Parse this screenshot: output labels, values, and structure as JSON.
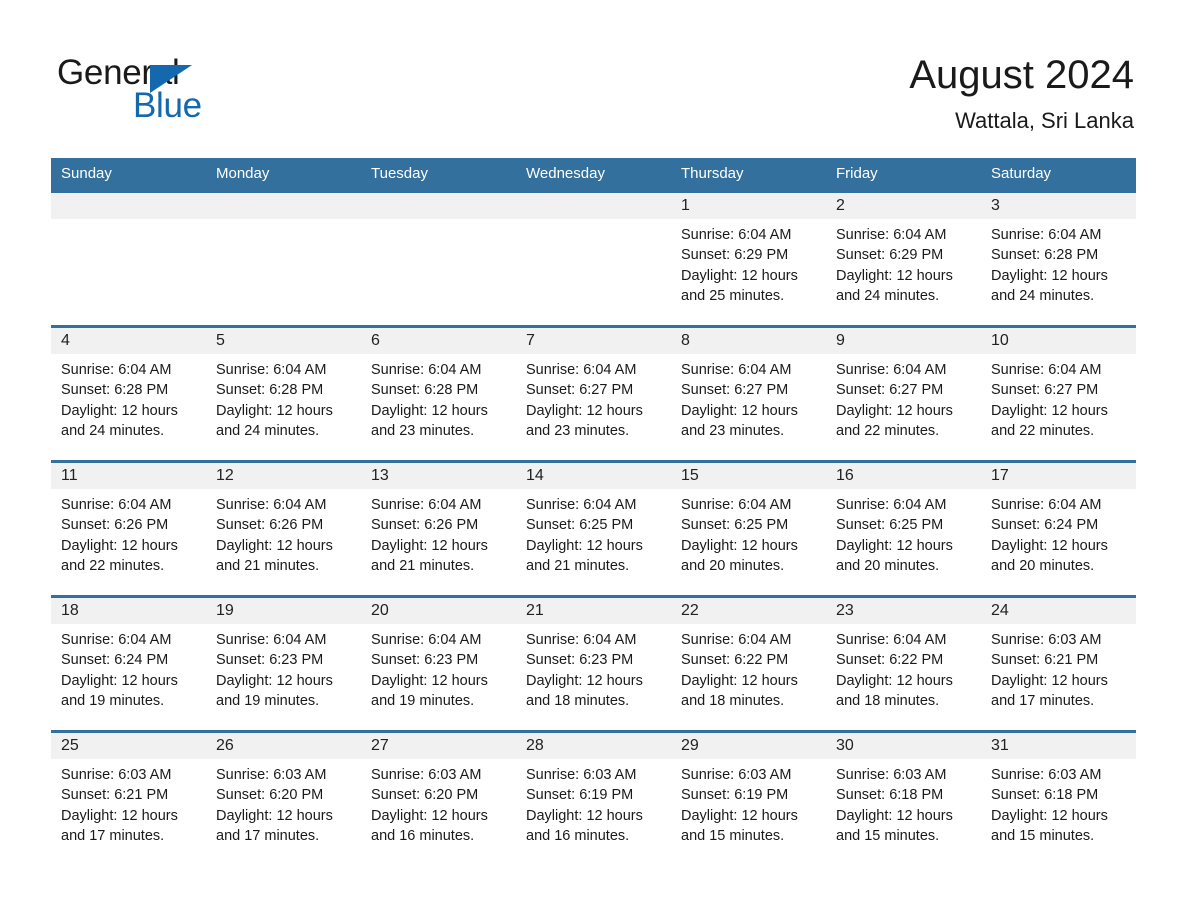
{
  "brand": {
    "name_line1": "General",
    "name_line2": "Blue",
    "accent_color": "#1468ad",
    "triangle_icon": "triangle-icon"
  },
  "header": {
    "month_title": "August 2024",
    "location": "Wattala, Sri Lanka"
  },
  "theme": {
    "header_bar_color": "#33709e",
    "day_band_color": "#f1f1f1",
    "row_rule_color": "#33709e",
    "text_color": "#1a1a1a"
  },
  "weekdays": [
    "Sunday",
    "Monday",
    "Tuesday",
    "Wednesday",
    "Thursday",
    "Friday",
    "Saturday"
  ],
  "weeks": [
    [
      {
        "day": "",
        "sunrise": "",
        "sunset": "",
        "daylight_line1": "",
        "daylight_line2": "",
        "empty": true
      },
      {
        "day": "",
        "sunrise": "",
        "sunset": "",
        "daylight_line1": "",
        "daylight_line2": "",
        "empty": true
      },
      {
        "day": "",
        "sunrise": "",
        "sunset": "",
        "daylight_line1": "",
        "daylight_line2": "",
        "empty": true
      },
      {
        "day": "",
        "sunrise": "",
        "sunset": "",
        "daylight_line1": "",
        "daylight_line2": "",
        "empty": true
      },
      {
        "day": "1",
        "sunrise": "Sunrise: 6:04 AM",
        "sunset": "Sunset: 6:29 PM",
        "daylight_line1": "Daylight: 12 hours",
        "daylight_line2": "and 25 minutes."
      },
      {
        "day": "2",
        "sunrise": "Sunrise: 6:04 AM",
        "sunset": "Sunset: 6:29 PM",
        "daylight_line1": "Daylight: 12 hours",
        "daylight_line2": "and 24 minutes."
      },
      {
        "day": "3",
        "sunrise": "Sunrise: 6:04 AM",
        "sunset": "Sunset: 6:28 PM",
        "daylight_line1": "Daylight: 12 hours",
        "daylight_line2": "and 24 minutes."
      }
    ],
    [
      {
        "day": "4",
        "sunrise": "Sunrise: 6:04 AM",
        "sunset": "Sunset: 6:28 PM",
        "daylight_line1": "Daylight: 12 hours",
        "daylight_line2": "and 24 minutes."
      },
      {
        "day": "5",
        "sunrise": "Sunrise: 6:04 AM",
        "sunset": "Sunset: 6:28 PM",
        "daylight_line1": "Daylight: 12 hours",
        "daylight_line2": "and 24 minutes."
      },
      {
        "day": "6",
        "sunrise": "Sunrise: 6:04 AM",
        "sunset": "Sunset: 6:28 PM",
        "daylight_line1": "Daylight: 12 hours",
        "daylight_line2": "and 23 minutes."
      },
      {
        "day": "7",
        "sunrise": "Sunrise: 6:04 AM",
        "sunset": "Sunset: 6:27 PM",
        "daylight_line1": "Daylight: 12 hours",
        "daylight_line2": "and 23 minutes."
      },
      {
        "day": "8",
        "sunrise": "Sunrise: 6:04 AM",
        "sunset": "Sunset: 6:27 PM",
        "daylight_line1": "Daylight: 12 hours",
        "daylight_line2": "and 23 minutes."
      },
      {
        "day": "9",
        "sunrise": "Sunrise: 6:04 AM",
        "sunset": "Sunset: 6:27 PM",
        "daylight_line1": "Daylight: 12 hours",
        "daylight_line2": "and 22 minutes."
      },
      {
        "day": "10",
        "sunrise": "Sunrise: 6:04 AM",
        "sunset": "Sunset: 6:27 PM",
        "daylight_line1": "Daylight: 12 hours",
        "daylight_line2": "and 22 minutes."
      }
    ],
    [
      {
        "day": "11",
        "sunrise": "Sunrise: 6:04 AM",
        "sunset": "Sunset: 6:26 PM",
        "daylight_line1": "Daylight: 12 hours",
        "daylight_line2": "and 22 minutes."
      },
      {
        "day": "12",
        "sunrise": "Sunrise: 6:04 AM",
        "sunset": "Sunset: 6:26 PM",
        "daylight_line1": "Daylight: 12 hours",
        "daylight_line2": "and 21 minutes."
      },
      {
        "day": "13",
        "sunrise": "Sunrise: 6:04 AM",
        "sunset": "Sunset: 6:26 PM",
        "daylight_line1": "Daylight: 12 hours",
        "daylight_line2": "and 21 minutes."
      },
      {
        "day": "14",
        "sunrise": "Sunrise: 6:04 AM",
        "sunset": "Sunset: 6:25 PM",
        "daylight_line1": "Daylight: 12 hours",
        "daylight_line2": "and 21 minutes."
      },
      {
        "day": "15",
        "sunrise": "Sunrise: 6:04 AM",
        "sunset": "Sunset: 6:25 PM",
        "daylight_line1": "Daylight: 12 hours",
        "daylight_line2": "and 20 minutes."
      },
      {
        "day": "16",
        "sunrise": "Sunrise: 6:04 AM",
        "sunset": "Sunset: 6:25 PM",
        "daylight_line1": "Daylight: 12 hours",
        "daylight_line2": "and 20 minutes."
      },
      {
        "day": "17",
        "sunrise": "Sunrise: 6:04 AM",
        "sunset": "Sunset: 6:24 PM",
        "daylight_line1": "Daylight: 12 hours",
        "daylight_line2": "and 20 minutes."
      }
    ],
    [
      {
        "day": "18",
        "sunrise": "Sunrise: 6:04 AM",
        "sunset": "Sunset: 6:24 PM",
        "daylight_line1": "Daylight: 12 hours",
        "daylight_line2": "and 19 minutes."
      },
      {
        "day": "19",
        "sunrise": "Sunrise: 6:04 AM",
        "sunset": "Sunset: 6:23 PM",
        "daylight_line1": "Daylight: 12 hours",
        "daylight_line2": "and 19 minutes."
      },
      {
        "day": "20",
        "sunrise": "Sunrise: 6:04 AM",
        "sunset": "Sunset: 6:23 PM",
        "daylight_line1": "Daylight: 12 hours",
        "daylight_line2": "and 19 minutes."
      },
      {
        "day": "21",
        "sunrise": "Sunrise: 6:04 AM",
        "sunset": "Sunset: 6:23 PM",
        "daylight_line1": "Daylight: 12 hours",
        "daylight_line2": "and 18 minutes."
      },
      {
        "day": "22",
        "sunrise": "Sunrise: 6:04 AM",
        "sunset": "Sunset: 6:22 PM",
        "daylight_line1": "Daylight: 12 hours",
        "daylight_line2": "and 18 minutes."
      },
      {
        "day": "23",
        "sunrise": "Sunrise: 6:04 AM",
        "sunset": "Sunset: 6:22 PM",
        "daylight_line1": "Daylight: 12 hours",
        "daylight_line2": "and 18 minutes."
      },
      {
        "day": "24",
        "sunrise": "Sunrise: 6:03 AM",
        "sunset": "Sunset: 6:21 PM",
        "daylight_line1": "Daylight: 12 hours",
        "daylight_line2": "and 17 minutes."
      }
    ],
    [
      {
        "day": "25",
        "sunrise": "Sunrise: 6:03 AM",
        "sunset": "Sunset: 6:21 PM",
        "daylight_line1": "Daylight: 12 hours",
        "daylight_line2": "and 17 minutes."
      },
      {
        "day": "26",
        "sunrise": "Sunrise: 6:03 AM",
        "sunset": "Sunset: 6:20 PM",
        "daylight_line1": "Daylight: 12 hours",
        "daylight_line2": "and 17 minutes."
      },
      {
        "day": "27",
        "sunrise": "Sunrise: 6:03 AM",
        "sunset": "Sunset: 6:20 PM",
        "daylight_line1": "Daylight: 12 hours",
        "daylight_line2": "and 16 minutes."
      },
      {
        "day": "28",
        "sunrise": "Sunrise: 6:03 AM",
        "sunset": "Sunset: 6:19 PM",
        "daylight_line1": "Daylight: 12 hours",
        "daylight_line2": "and 16 minutes."
      },
      {
        "day": "29",
        "sunrise": "Sunrise: 6:03 AM",
        "sunset": "Sunset: 6:19 PM",
        "daylight_line1": "Daylight: 12 hours",
        "daylight_line2": "and 15 minutes."
      },
      {
        "day": "30",
        "sunrise": "Sunrise: 6:03 AM",
        "sunset": "Sunset: 6:18 PM",
        "daylight_line1": "Daylight: 12 hours",
        "daylight_line2": "and 15 minutes."
      },
      {
        "day": "31",
        "sunrise": "Sunrise: 6:03 AM",
        "sunset": "Sunset: 6:18 PM",
        "daylight_line1": "Daylight: 12 hours",
        "daylight_line2": "and 15 minutes."
      }
    ]
  ]
}
